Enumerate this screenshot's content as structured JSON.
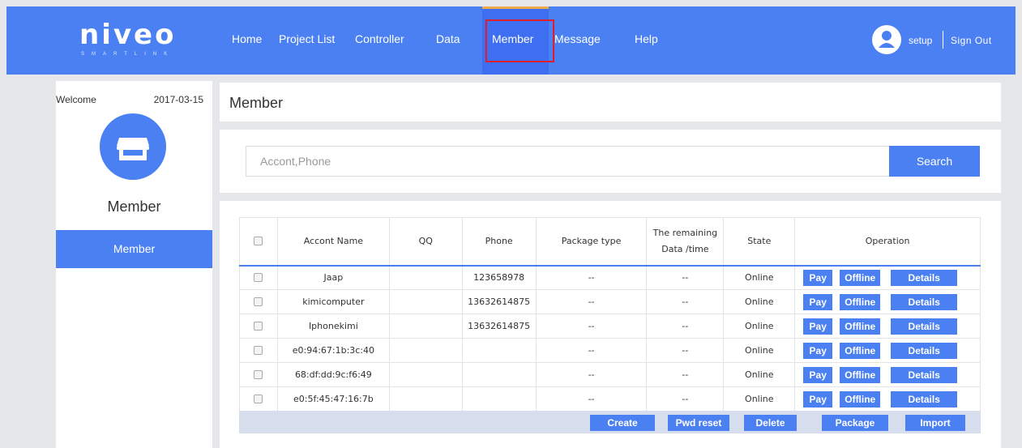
{
  "header": {
    "logo": "niveo",
    "logo_sub": "SMARTLINK",
    "nav": [
      "Home",
      "Project List",
      "Controller",
      "Data",
      "Member",
      "Message",
      "Help"
    ],
    "active_nav": "Member",
    "user": "setup",
    "sign_out": "Sign Out"
  },
  "sidebar": {
    "welcome": "Welcome",
    "date": "2017-03-15",
    "icon": "store-icon",
    "title": "Member",
    "items": [
      {
        "label": "Member",
        "active": true
      }
    ]
  },
  "main": {
    "title": "Member",
    "search": {
      "placeholder": "Accont,Phone",
      "value": "",
      "button": "Search"
    },
    "table": {
      "headers": [
        "Accont Name",
        "QQ",
        "Phone",
        "Package type",
        "The remaining",
        "Data /time",
        "State",
        "Operation"
      ],
      "rows": [
        {
          "name": "Jaap",
          "qq": "",
          "phone": "123658978",
          "package": "--",
          "remaining": "--",
          "state": "Online"
        },
        {
          "name": "kimicomputer",
          "qq": "",
          "phone": "13632614875",
          "package": "--",
          "remaining": "--",
          "state": "Online"
        },
        {
          "name": "Iphonekimi",
          "qq": "",
          "phone": "13632614875",
          "package": "--",
          "remaining": "--",
          "state": "Online"
        },
        {
          "name": "e0:94:67:1b:3c:40",
          "qq": "",
          "phone": "",
          "package": "--",
          "remaining": "--",
          "state": "Online"
        },
        {
          "name": "68:df:dd:9c:f6:49",
          "qq": "",
          "phone": "",
          "package": "--",
          "remaining": "--",
          "state": "Online"
        },
        {
          "name": "e0:5f:45:47:16:7b",
          "qq": "",
          "phone": "",
          "package": "--",
          "remaining": "--",
          "state": "Online"
        }
      ],
      "row_actions": [
        "Pay",
        "Offline",
        "Details"
      ],
      "footer_actions": [
        "Create",
        "Pwd reset",
        "Delete",
        "Package",
        "Import"
      ]
    }
  },
  "colors": {
    "primary": "#4b80f2",
    "active_nav_bg": "#3d6ff0",
    "highlight": "#e01e2b",
    "footer_bar": "#d6ddec",
    "page_bg": "#e6e7ea"
  }
}
